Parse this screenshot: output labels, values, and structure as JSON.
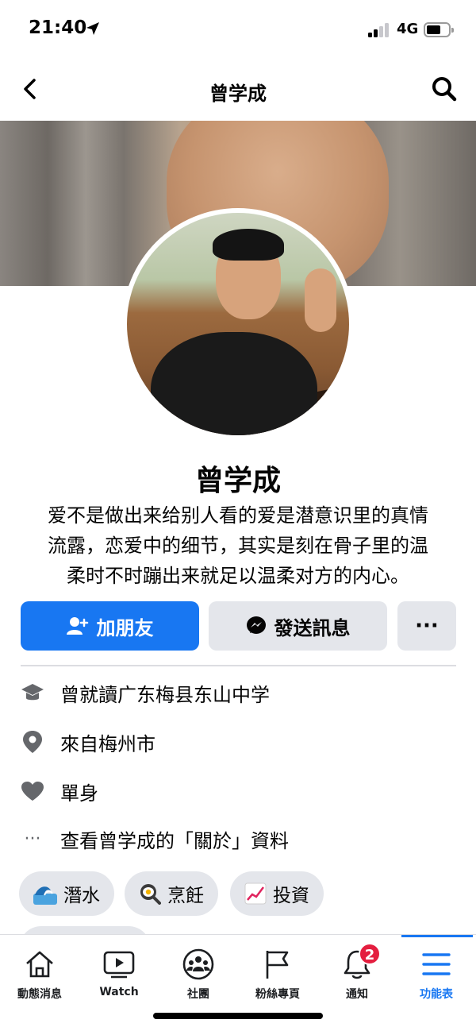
{
  "status": {
    "time": "21:40",
    "network": "4G"
  },
  "header": {
    "title": "曾学成"
  },
  "profile": {
    "name": "曾学成",
    "bio_lines": [
      "爱不是做出来给别人看的爱是潜意识里的真情",
      "流露，恋爱中的细节，其实是刻在骨子里的温",
      "柔时不时蹦出来就足以温柔对方的内心。"
    ]
  },
  "actions": {
    "add_friend": "加朋友",
    "message": "發送訊息",
    "more": "···"
  },
  "info": {
    "education": "曾就讀广东梅县东山中学",
    "from": "來自梅州市",
    "relationship": "單身",
    "about": "查看曾学成的「關於」資料",
    "more_icon": "···"
  },
  "hobbies": [
    {
      "label": "潛水",
      "icon": "wave-emoji"
    },
    {
      "label": "烹飪",
      "icon": "cooking-emoji"
    },
    {
      "label": "投資",
      "icon": "chart-emoji"
    }
  ],
  "nav": {
    "items": [
      {
        "label": "動態消息",
        "icon": "home-icon"
      },
      {
        "label": "Watch",
        "icon": "watch-icon"
      },
      {
        "label": "社團",
        "icon": "groups-icon"
      },
      {
        "label": "粉絲專頁",
        "icon": "flag-icon"
      },
      {
        "label": "通知",
        "icon": "bell-icon"
      },
      {
        "label": "功能表",
        "icon": "menu-icon"
      }
    ],
    "notification_badge": "2",
    "active": "功能表"
  },
  "colors": {
    "accent": "#1877f2",
    "button_gray": "#e4e6eb",
    "badge": "#e41e3f"
  }
}
